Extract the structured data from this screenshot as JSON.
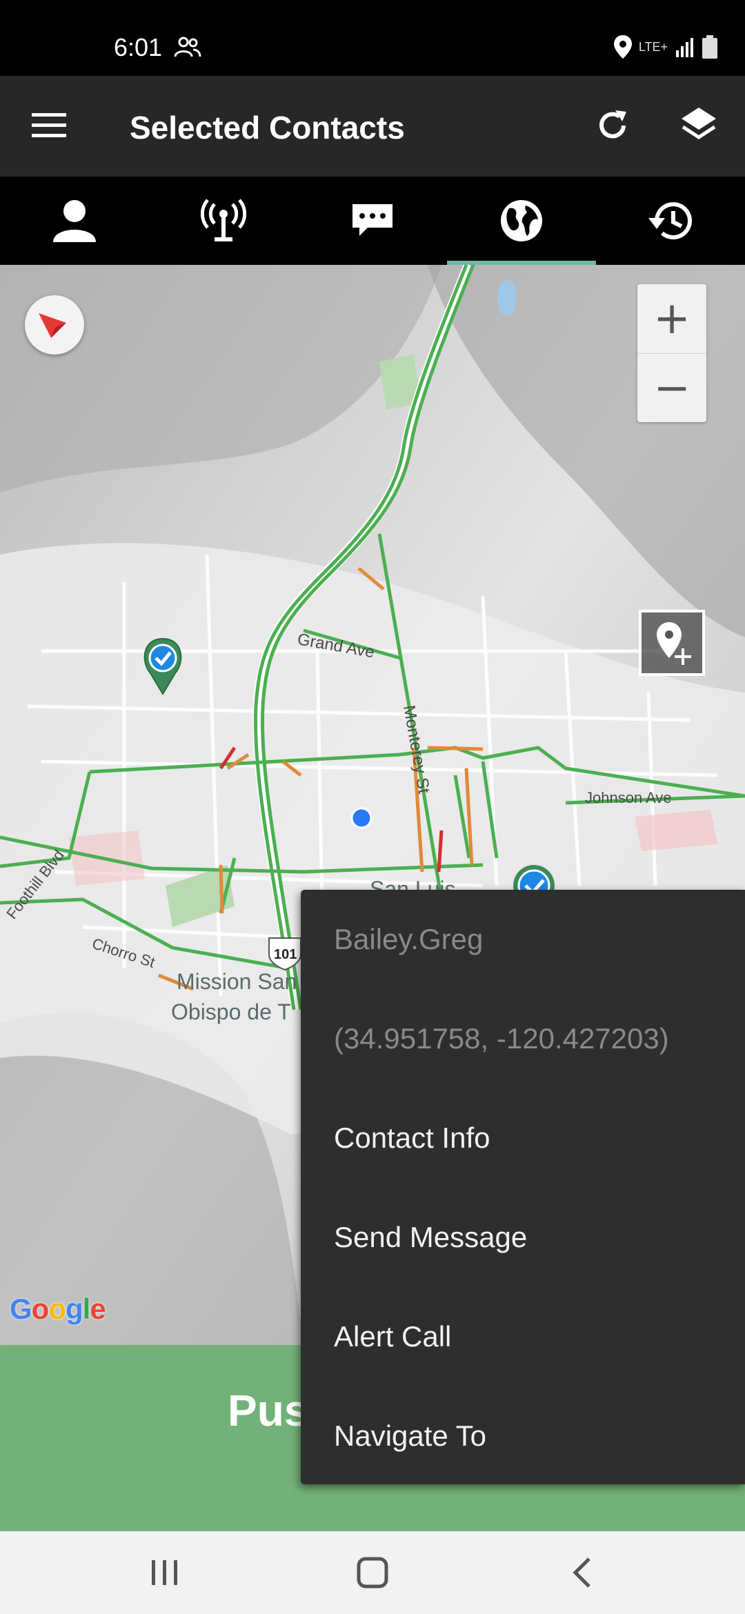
{
  "status_bar": {
    "time": "6:01",
    "network": "LTE+",
    "icons": [
      "people-icon",
      "location-icon",
      "signal-icon",
      "battery-icon"
    ]
  },
  "app_bar": {
    "title": "Selected Contacts",
    "icons": [
      "menu-icon",
      "refresh-icon",
      "layers-icon"
    ]
  },
  "tabs": [
    {
      "name": "contacts",
      "icon": "person-icon",
      "active": false
    },
    {
      "name": "radio",
      "icon": "antenna-icon",
      "active": false
    },
    {
      "name": "messages",
      "icon": "chat-icon",
      "active": false
    },
    {
      "name": "map",
      "icon": "globe-icon",
      "active": true
    },
    {
      "name": "history",
      "icon": "history-icon",
      "active": false
    }
  ],
  "map": {
    "zoom_in": "+",
    "zoom_out": "−",
    "labels": {
      "grand_ave": "Grand Ave",
      "monterey_st": "Monterey St",
      "johnson_ave": "Johnson Ave",
      "foothill_blvd": "Foothill Blvd",
      "chorro_st": "Chorro St",
      "mission_1": "Mission San",
      "mission_2": "Obispo de T",
      "san_luis": "San Luis",
      "hwy_101": "101"
    },
    "google": "Google",
    "colors": {
      "road_green": "#4caf50",
      "road_orange": "#e08a3a",
      "road_red": "#d32f2f",
      "marker_green": "#3c8a5a",
      "marker_check": "#1e88e5"
    }
  },
  "bottom_bar": {
    "label": "Pus",
    "color": "#72b177"
  },
  "popup": {
    "contact_name": "Bailey.Greg",
    "coordinates": "(34.951758, -120.427203)",
    "items": [
      "Contact Info",
      "Send Message",
      "Alert Call",
      "Navigate To"
    ]
  }
}
